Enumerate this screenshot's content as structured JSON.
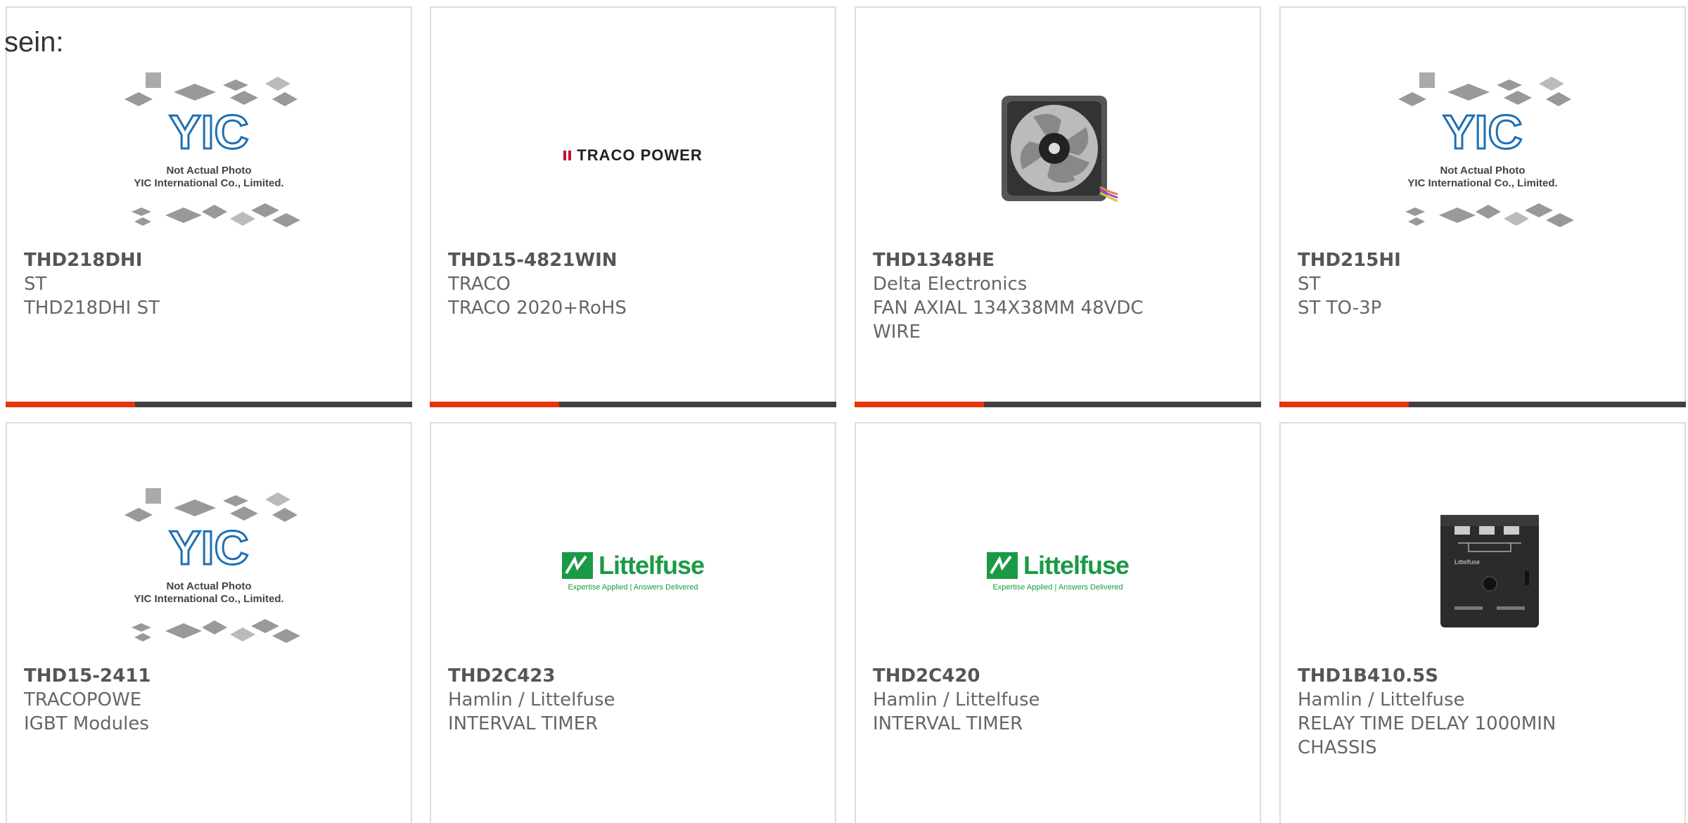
{
  "intro_text": "sein:",
  "products": [
    {
      "part": "THD218DHI",
      "brand": "ST",
      "desc": "THD218DHI ST",
      "image": "yic-placeholder",
      "image_caption": [
        "Not Actual Photo",
        "YIC International Co., Limited."
      ]
    },
    {
      "part": "THD15-4821WIN",
      "brand": "TRACO",
      "desc": "TRACO 2020+RoHS",
      "image": "traco-power-logo",
      "image_caption": [
        "TRACO POWER"
      ]
    },
    {
      "part": "THD1348HE",
      "brand": "Delta Electronics",
      "desc": "FAN AXIAL 134X38MM 48VDC WIRE",
      "image": "fan-photo"
    },
    {
      "part": "THD215HI",
      "brand": "ST",
      "desc": "ST TO-3P",
      "image": "yic-placeholder",
      "image_caption": [
        "Not Actual Photo",
        "YIC International Co., Limited."
      ]
    },
    {
      "part": "THD15-2411",
      "brand": "TRACOPOWE",
      "desc": "IGBT Modules",
      "image": "yic-placeholder",
      "image_caption": [
        "Not Actual Photo",
        "YIC International Co., Limited."
      ]
    },
    {
      "part": "THD2C423",
      "brand": "Hamlin / Littelfuse",
      "desc": "INTERVAL TIMER",
      "image": "littelfuse-logo",
      "image_caption": [
        "Littelfuse",
        "Expertise Applied | Answers Delivered"
      ]
    },
    {
      "part": "THD2C420",
      "brand": "Hamlin / Littelfuse",
      "desc": "INTERVAL TIMER",
      "image": "littelfuse-logo",
      "image_caption": [
        "Littelfuse",
        "Expertise Applied | Answers Delivered"
      ]
    },
    {
      "part": "THD1B410.5S",
      "brand": "Hamlin / Littelfuse",
      "desc": "RELAY TIME DELAY 1000MIN CHASSIS",
      "image": "relay-photo"
    }
  ],
  "colors": {
    "accent": "#e8340b",
    "bar": "#404040",
    "border": "#dddddd",
    "littelfuse": "#1a9a46",
    "traco": "#c8102e"
  }
}
